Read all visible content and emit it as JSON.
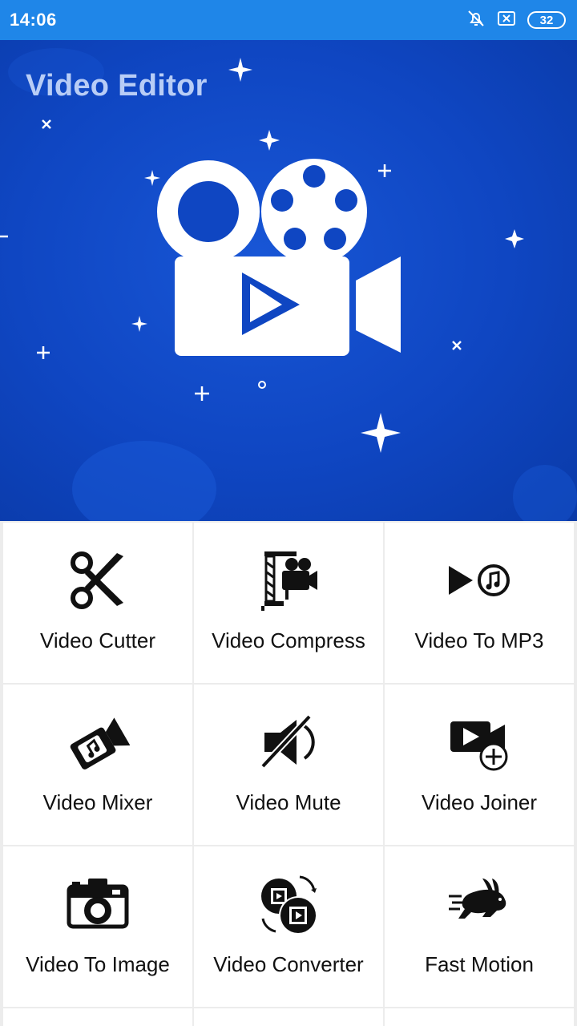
{
  "status_bar": {
    "time": "14:06",
    "battery": "32",
    "icons": [
      "bell-off-icon",
      "sim-off-icon",
      "battery-icon"
    ]
  },
  "banner": {
    "title": "Video Editor",
    "logo_icon": "video-camera-reel-icon",
    "colors": {
      "background": "#0f46c2",
      "title": "#b8cdf6"
    }
  },
  "tools": [
    {
      "label": "Video Cutter",
      "icon": "scissors-icon"
    },
    {
      "label": "Video Compress",
      "icon": "compress-camera-icon"
    },
    {
      "label": "Video To MP3",
      "icon": "play-music-icon"
    },
    {
      "label": "Video Mixer",
      "icon": "camera-music-icon"
    },
    {
      "label": "Video Mute",
      "icon": "speaker-mute-icon"
    },
    {
      "label": "Video Joiner",
      "icon": "camera-add-icon"
    },
    {
      "label": "Video To Image",
      "icon": "photo-camera-icon"
    },
    {
      "label": "Video Converter",
      "icon": "convert-film-icon"
    },
    {
      "label": "Fast Motion",
      "icon": "rabbit-icon"
    }
  ]
}
